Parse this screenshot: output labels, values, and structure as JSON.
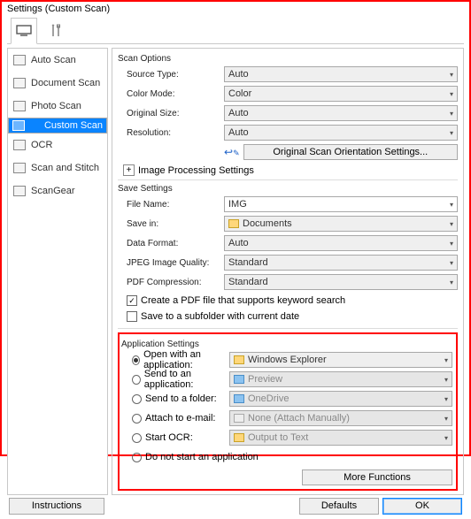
{
  "title": "Settings (Custom Scan)",
  "sidebar": {
    "items": [
      {
        "label": "Auto Scan"
      },
      {
        "label": "Document Scan"
      },
      {
        "label": "Photo Scan"
      },
      {
        "label": "Custom Scan"
      },
      {
        "label": "OCR"
      },
      {
        "label": "Scan and Stitch"
      },
      {
        "label": "ScanGear"
      }
    ]
  },
  "scan_options": {
    "title": "Scan Options",
    "source_type": {
      "label": "Source Type:",
      "value": "Auto"
    },
    "color_mode": {
      "label": "Color Mode:",
      "value": "Color"
    },
    "original_size": {
      "label": "Original Size:",
      "value": "Auto"
    },
    "resolution": {
      "label": "Resolution:",
      "value": "Auto"
    },
    "orientation_btn": "Original Scan Orientation Settings...",
    "image_proc": "Image Processing Settings"
  },
  "save_settings": {
    "title": "Save Settings",
    "file_name": {
      "label": "File Name:",
      "value": "IMG"
    },
    "save_in": {
      "label": "Save in:",
      "value": "Documents"
    },
    "data_format": {
      "label": "Data Format:",
      "value": "Auto"
    },
    "jpeg_quality": {
      "label": "JPEG Image Quality:",
      "value": "Standard"
    },
    "pdf_compression": {
      "label": "PDF Compression:",
      "value": "Standard"
    },
    "chk_pdf": "Create a PDF file that supports keyword search",
    "chk_subfolder": "Save to a subfolder with current date"
  },
  "app_settings": {
    "title": "Application Settings",
    "open_with": {
      "label": "Open with an application:",
      "value": "Windows Explorer"
    },
    "send_app": {
      "label": "Send to an application:",
      "value": "Preview"
    },
    "send_folder": {
      "label": "Send to a folder:",
      "value": "OneDrive"
    },
    "attach_email": {
      "label": "Attach to e-mail:",
      "value": "None (Attach Manually)"
    },
    "start_ocr": {
      "label": "Start OCR:",
      "value": "Output to Text"
    },
    "do_not_start": "Do not start an application",
    "more_functions": "More Functions"
  },
  "footer": {
    "instructions": "Instructions",
    "defaults": "Defaults",
    "ok": "OK"
  }
}
